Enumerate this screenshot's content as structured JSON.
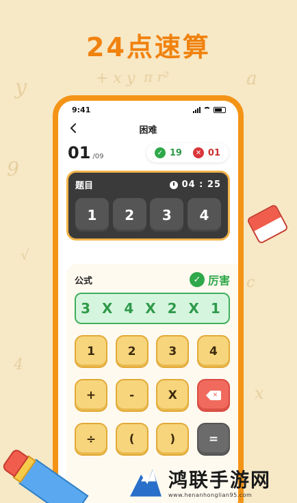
{
  "promo": {
    "title": "24点速算"
  },
  "status_bar": {
    "time": "9:41"
  },
  "nav": {
    "title": "困难",
    "back_icon": "chevron-left-icon"
  },
  "progress": {
    "current": "01",
    "total": "/09"
  },
  "score": {
    "correct": "19",
    "wrong": "01",
    "correct_icon": "check-circle-icon",
    "wrong_icon": "x-circle-icon"
  },
  "problem": {
    "label": "题目",
    "timer": "04 : 25",
    "numbers": [
      "1",
      "2",
      "3",
      "4"
    ]
  },
  "formula": {
    "label": "公式",
    "praise": "厉害",
    "expression": "3 X 4 X 2 X 1"
  },
  "keypad": {
    "keys": [
      "1",
      "2",
      "3",
      "4",
      "+",
      "-",
      "X",
      "",
      "÷",
      "(",
      ")",
      "="
    ],
    "delete_icon": "backspace-icon"
  },
  "watermark": {
    "name": "鸿联手游网",
    "url": "www.henanhonglian95.com"
  },
  "colors": {
    "accent": "#f39417",
    "background": "#f7e8c6",
    "dark_card": "#3a3a3a",
    "key_yellow": "#f6d57c",
    "success_green": "#2fa84a",
    "error_red": "#d9353a"
  }
}
